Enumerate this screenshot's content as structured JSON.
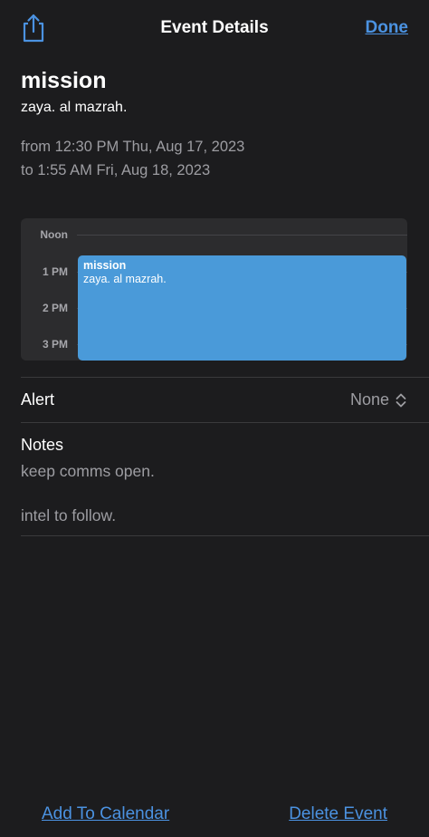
{
  "nav": {
    "title": "Event Details",
    "done_label": "Done",
    "share_icon": "share-icon"
  },
  "event": {
    "title": "mission",
    "location": "zaya. al mazrah.",
    "from": "from 12:30 PM Thu, Aug 17, 2023",
    "to": "to 1:55 AM Fri, Aug 18, 2023"
  },
  "day_preview": {
    "hours": [
      "Noon",
      "1 PM",
      "2 PM",
      "3 PM"
    ],
    "block_title": "mission",
    "block_location": "zaya. al mazrah.",
    "block_color": "#4a9ad9"
  },
  "alert": {
    "label": "Alert",
    "value": "None",
    "icon": "up-down-chevron-icon"
  },
  "notes": {
    "label": "Notes",
    "lines": [
      "keep comms open.",
      "intel to follow."
    ]
  },
  "actions": {
    "add_label": "Add To Calendar",
    "delete_label": "Delete Event"
  },
  "colors": {
    "background": "#1c1c1e",
    "accent": "#4b92e1",
    "secondary_text": "#9d9da2"
  }
}
